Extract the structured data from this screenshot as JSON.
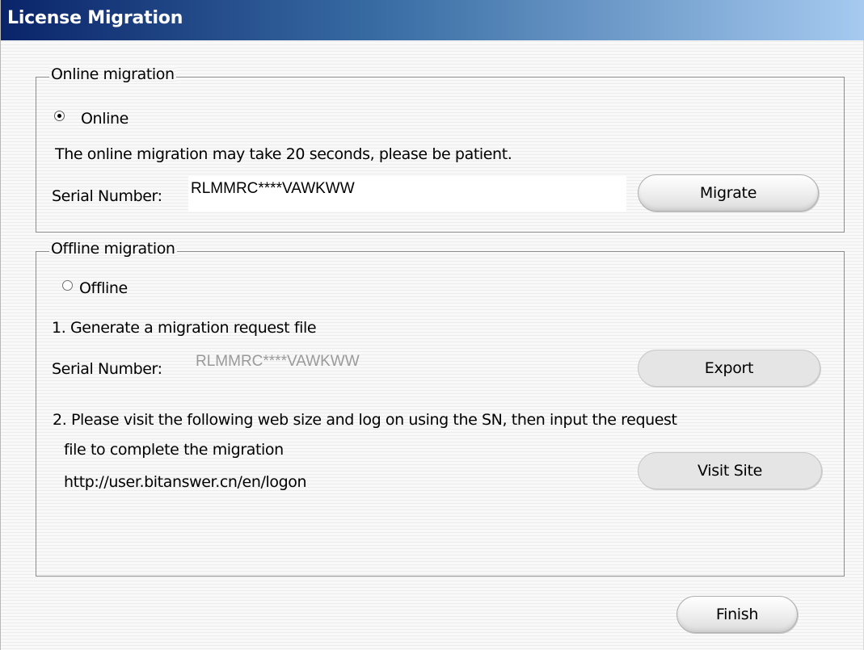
{
  "window": {
    "title": "License Migration"
  },
  "online": {
    "group_label": "Online migration",
    "radio_label": "Online",
    "radio_checked": true,
    "note": "The online migration may take 20 seconds, please be patient.",
    "serial_label": "Serial Number:",
    "serial_value": "RLMMRC****VAWKWW",
    "migrate_button": "Migrate"
  },
  "offline": {
    "group_label": "Offline migration",
    "radio_label": "Offline",
    "radio_checked": false,
    "step1": "1. Generate a migration request file",
    "serial_label": "Serial Number:",
    "serial_value": "RLMMRC****VAWKWW",
    "export_button": "Export",
    "step2_line1": "2. Please visit the following web size and log on using the SN, then input the request",
    "step2_line2": "file to complete the migration",
    "url": "http://user.bitanswer.cn/en/logon",
    "visit_button": "Visit Site"
  },
  "footer": {
    "finish_button": "Finish"
  }
}
